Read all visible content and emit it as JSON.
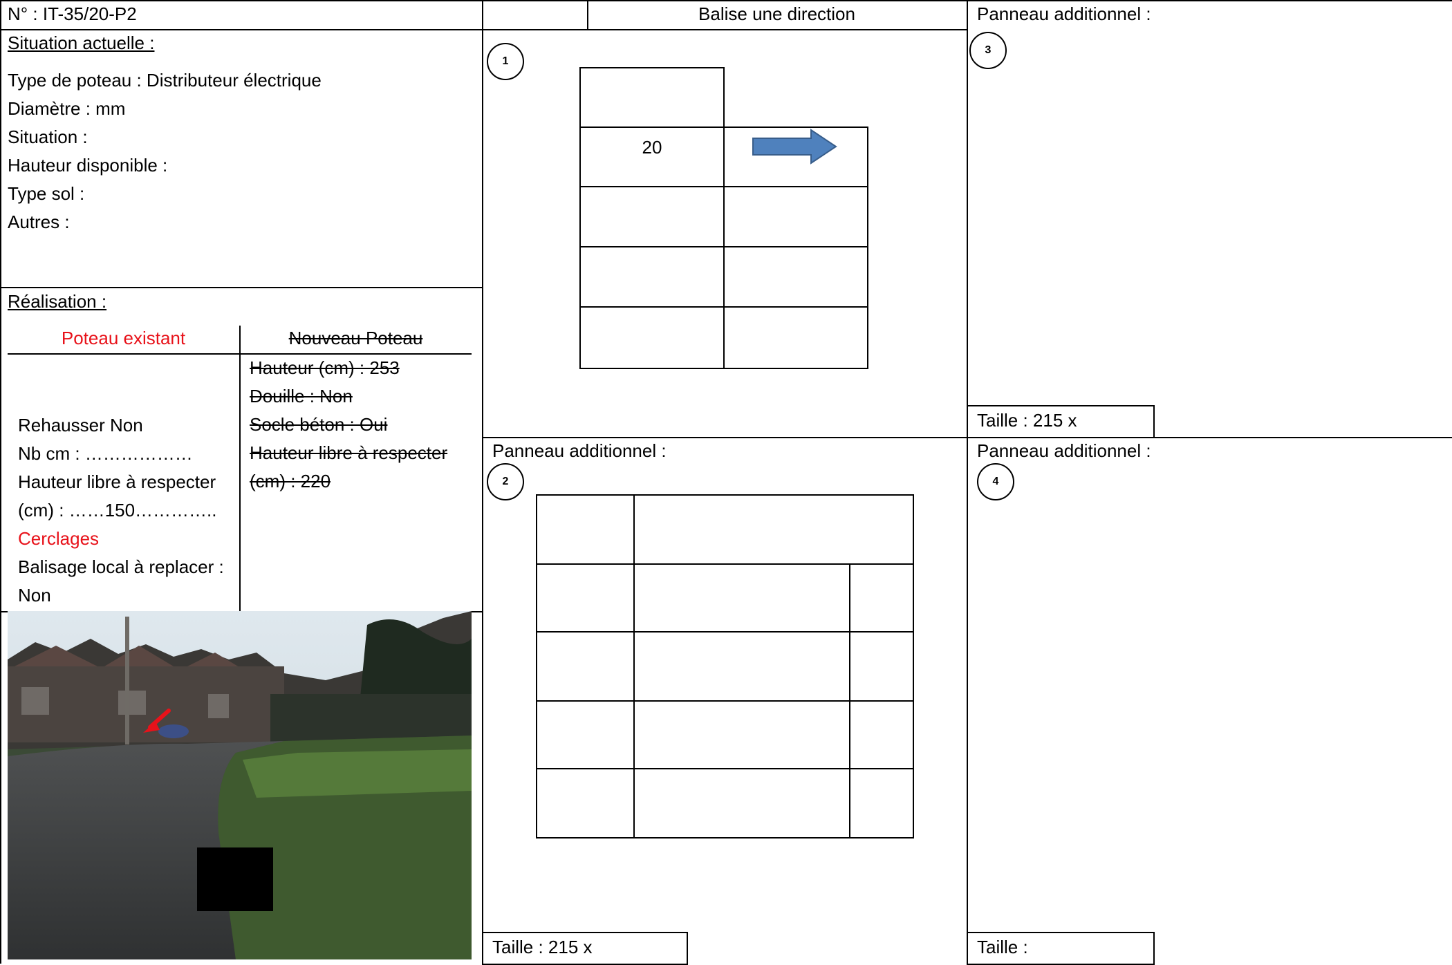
{
  "header": {
    "ref": "N° : IT-35/20-P2",
    "balise_title": "Balise une direction",
    "panel3_title": "Panneau additionnel :"
  },
  "situation": {
    "heading": "Situation actuelle :",
    "lines": [
      "Type de poteau : Distributeur électrique",
      "Diamètre : mm",
      "Situation :",
      "Hauteur disponible :",
      "Type sol :",
      "Autres :"
    ]
  },
  "realisation": {
    "heading": "Réalisation :",
    "col_existing": "Poteau existant",
    "col_new": "Nouveau Poteau",
    "existing_lines": [
      "Rehausser Non",
      "Nb cm : ………………",
      "Hauteur libre à respecter",
      "(cm) : ……150…………..",
      "Cerclages",
      "Balisage local à replacer :",
      "Non"
    ],
    "new_lines": [
      "Hauteur (cm) : 253",
      "Douille : Non",
      "Socle béton : Oui",
      "Hauteur libre à respecter",
      "(cm) : 220"
    ]
  },
  "panels": {
    "p1": {
      "number": "1",
      "cell_value": "20",
      "arrow": "right-arrow-icon",
      "arrow_color": "#4f81bd"
    },
    "p2": {
      "title": "Panneau additionnel :",
      "number": "2",
      "size": "Taille : 215 x"
    },
    "p3": {
      "number": "3",
      "size": "Taille : 215 x"
    },
    "p4": {
      "title": "Panneau additionnel :",
      "number": "4",
      "size": "Taille :"
    }
  },
  "colors": {
    "accent_red": "#e8121a",
    "arrow_blue": "#4f81bd"
  }
}
